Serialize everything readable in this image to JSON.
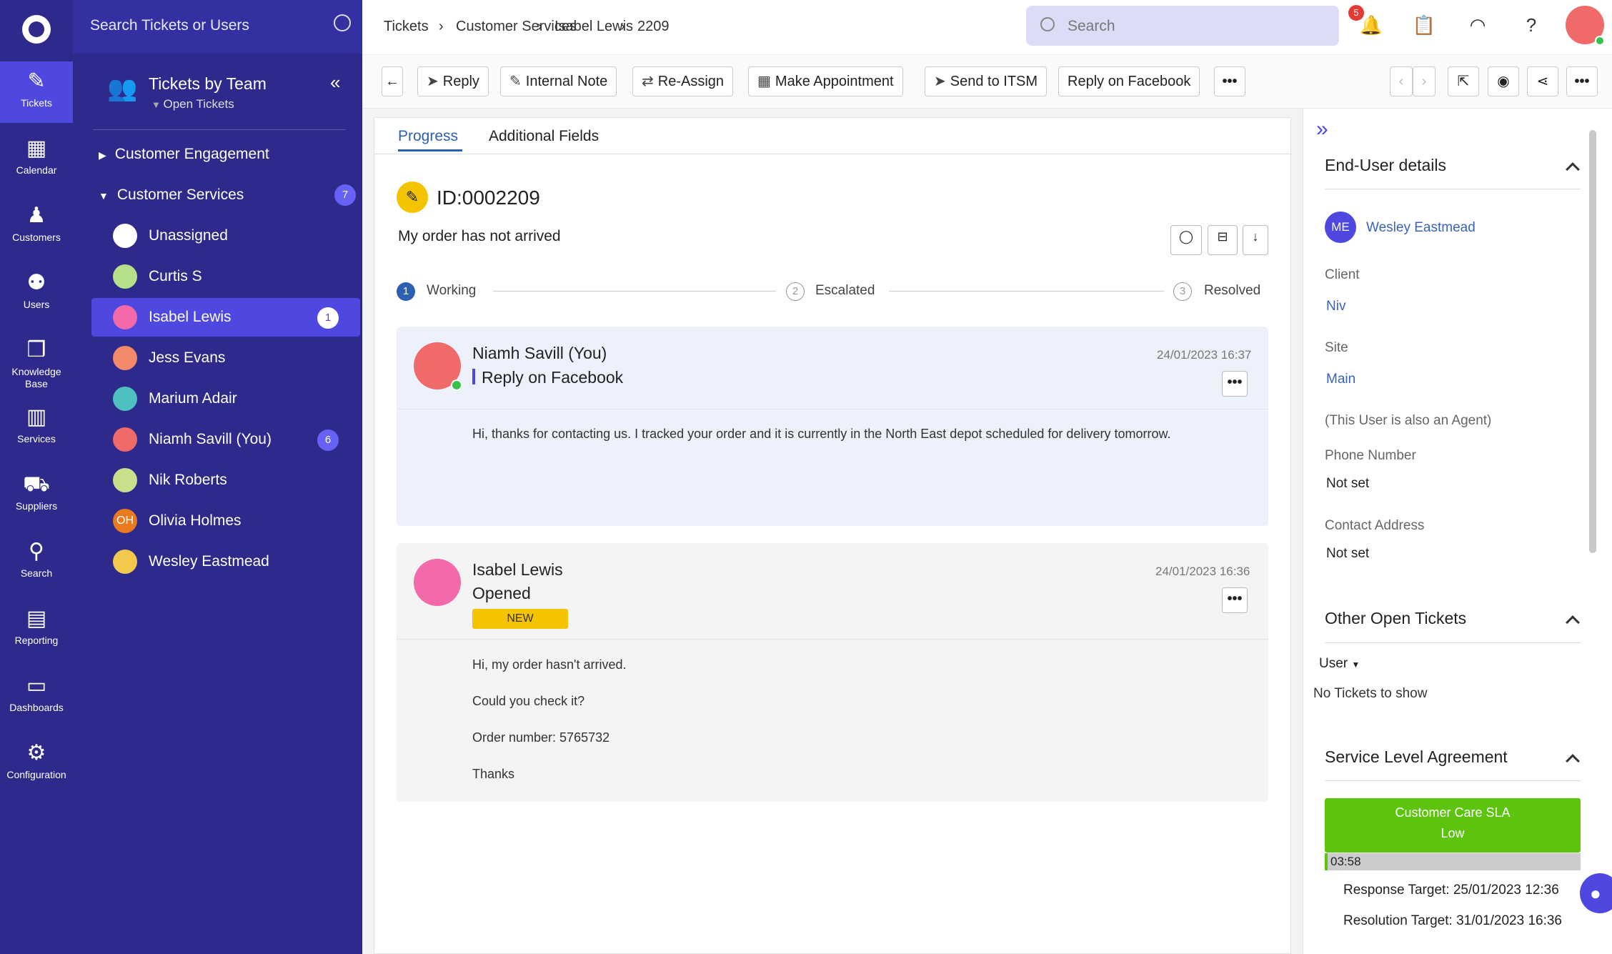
{
  "rail": {
    "items": [
      {
        "label": "Tickets",
        "icon": "ticket-icon",
        "glyph": "✎"
      },
      {
        "label": "Calendar",
        "icon": "calendar-icon",
        "glyph": "▦"
      },
      {
        "label": "Customers",
        "icon": "customer-icon",
        "glyph": "♟"
      },
      {
        "label": "Users",
        "icon": "users-icon",
        "glyph": "⚉"
      },
      {
        "label": "Knowledge",
        "label2": "Base",
        "icon": "knowledge-base-icon",
        "glyph": "❒"
      },
      {
        "label": "Services",
        "icon": "services-icon",
        "glyph": "▥"
      },
      {
        "label": "Suppliers",
        "icon": "truck-icon",
        "glyph": "⛟"
      },
      {
        "label": "Search",
        "icon": "search-icon",
        "glyph": "⚲"
      },
      {
        "label": "Reporting",
        "icon": "report-icon",
        "glyph": "▤"
      },
      {
        "label": "Dashboards",
        "icon": "monitor-icon",
        "glyph": "▭"
      },
      {
        "label": "Configuration",
        "icon": "gear-icon",
        "glyph": "⚙"
      }
    ]
  },
  "team": {
    "search_placeholder": "Search Tickets or Users",
    "title": "Tickets by Team",
    "subtitle": "Open Tickets",
    "groups": [
      {
        "label": "Customer Engagement",
        "arrow": "▶"
      },
      {
        "label": "Customer Services",
        "arrow": "▼",
        "count": "7"
      }
    ],
    "agents": [
      {
        "name": "Unassigned",
        "initials": "",
        "bg": "#ffffff"
      },
      {
        "name": "Curtis S",
        "initials": "",
        "bg": "#b7e08b"
      },
      {
        "name": "Isabel Lewis",
        "initials": "",
        "bg": "#f26aa9",
        "count": "1",
        "active": true
      },
      {
        "name": "Jess Evans",
        "initials": "",
        "bg": "#f3896b"
      },
      {
        "name": "Marium Adair",
        "initials": "",
        "bg": "#4fc0c0"
      },
      {
        "name": "Niamh Savill (You)",
        "initials": "",
        "bg": "#f06a6a",
        "count": "6"
      },
      {
        "name": "Nik Roberts",
        "initials": "",
        "bg": "#c8e08b"
      },
      {
        "name": "Olivia Holmes",
        "initials": "OH",
        "bg": "#ea7a1e"
      },
      {
        "name": "Wesley Eastmead",
        "initials": "",
        "bg": "#f2c94c"
      }
    ]
  },
  "breadcrumb": [
    "Tickets",
    "Customer Services",
    "Isabel Lewis",
    "2209"
  ],
  "global_search_placeholder": "Search",
  "notifications_count": "5",
  "toolbar": {
    "reply": "Reply",
    "internal_note": "Internal Note",
    "reassign": "Re-Assign",
    "appointment": "Make Appointment",
    "itsm": "Send to ITSM",
    "facebook": "Reply on Facebook",
    "more": "•••"
  },
  "tabs": [
    "Progress",
    "Additional Fields"
  ],
  "ticket": {
    "id": "ID:0002209",
    "summary": "My order has not arrived",
    "steps": [
      {
        "n": "1",
        "label": "Working"
      },
      {
        "n": "2",
        "label": "Escalated"
      },
      {
        "n": "3",
        "label": "Resolved"
      }
    ]
  },
  "messages": [
    {
      "author": "Niamh Savill (You)",
      "type": "Reply on Facebook",
      "time": "24/01/2023 16:37",
      "body": [
        "Hi, thanks for contacting us. I tracked your order and it is currently in the North East depot scheduled for delivery tomorrow."
      ]
    },
    {
      "author": "Isabel Lewis",
      "type": "Opened",
      "status": "NEW",
      "time": "24/01/2023 16:36",
      "body": [
        "Hi, my order hasn't arrived.",
        "Could you check it?",
        "Order number: 5765732",
        "Thanks"
      ]
    }
  ],
  "enduser": {
    "heading": "End-User details",
    "initials": "ME",
    "name": "Wesley Eastmead",
    "client_label": "Client",
    "client": "Niv",
    "site_label": "Site",
    "site": "Main",
    "agent_note": "(This User is also an Agent)",
    "phone_label": "Phone Number",
    "phone": "Not set",
    "address_label": "Contact Address",
    "address": "Not set"
  },
  "other_tickets": {
    "heading": "Other Open Tickets",
    "filter": "User",
    "empty": "No Tickets to show"
  },
  "sla": {
    "heading": "Service Level Agreement",
    "name": "Customer Care SLA",
    "priority": "Low",
    "timer": "03:58",
    "response": "Response Target: 25/01/2023 12:36",
    "resolution": "Resolution Target: 31/01/2023 16:36",
    "color": "#5cc40c"
  }
}
